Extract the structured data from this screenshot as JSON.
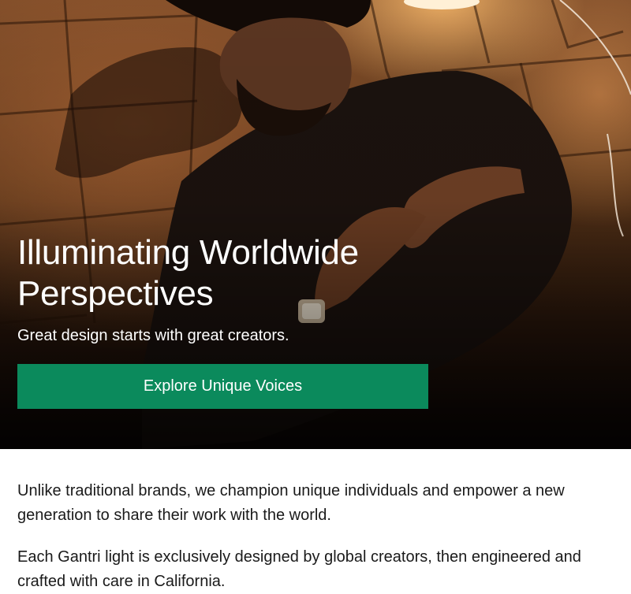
{
  "hero": {
    "image_alt": "Man lying on a tiled floor lit by a warm lamp",
    "title": "Illuminating Worldwide Perspectives",
    "subtitle": "Great design starts with great creators.",
    "cta_label": "Explore Unique Voices",
    "cta_color": "#0b8a5c"
  },
  "body": {
    "paragraphs": [
      "Unlike traditional brands, we champion unique individuals and empower a new generation to share their work with the world.",
      "Each Gantri light is exclusively designed by global creators, then engineered and crafted with care in California."
    ]
  }
}
